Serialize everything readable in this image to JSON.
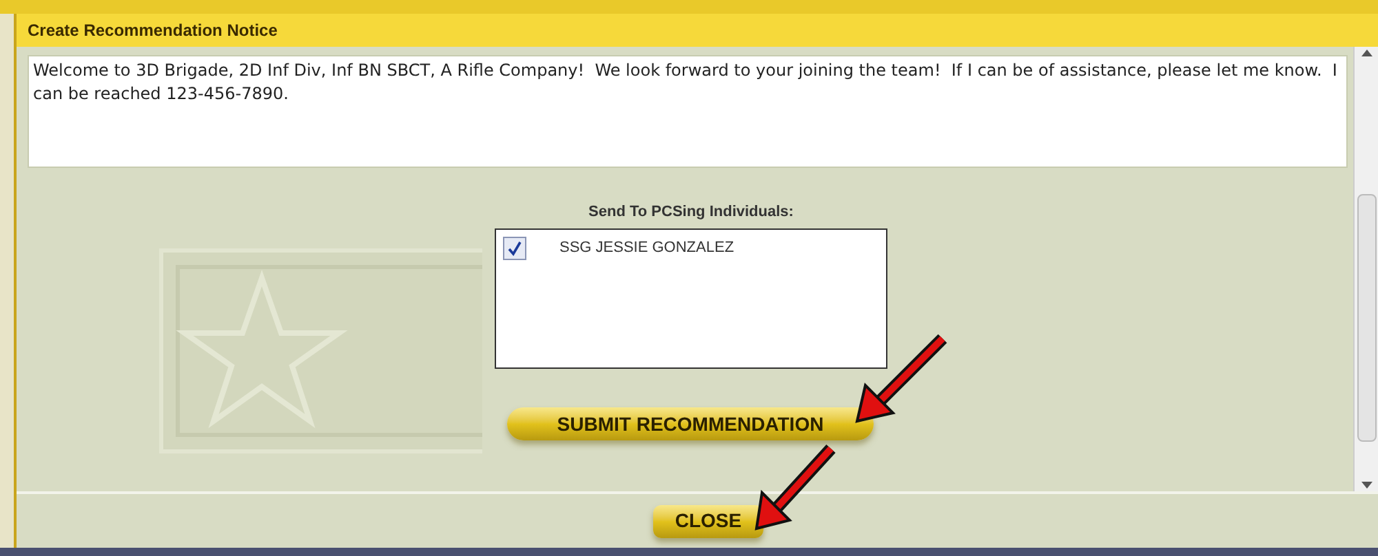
{
  "window": {
    "title": "Create Recommendation Notice"
  },
  "message": {
    "value": "Welcome to 3D Brigade, 2D Inf Div, Inf BN SBCT, A Rifle Company!  We look forward to your joining the team!  If I can be of assistance, please let me know.  I can be reached 123-456-7890."
  },
  "recipients": {
    "label": "Send To PCSing Individuals:",
    "items": [
      {
        "name": "SSG JESSIE GONZALEZ",
        "checked": true
      }
    ]
  },
  "buttons": [
    {
      "label": "SUBMIT RECOMMENDATION",
      "kind": "primary"
    },
    {
      "label": "CLOSE",
      "kind": "footer"
    }
  ]
}
